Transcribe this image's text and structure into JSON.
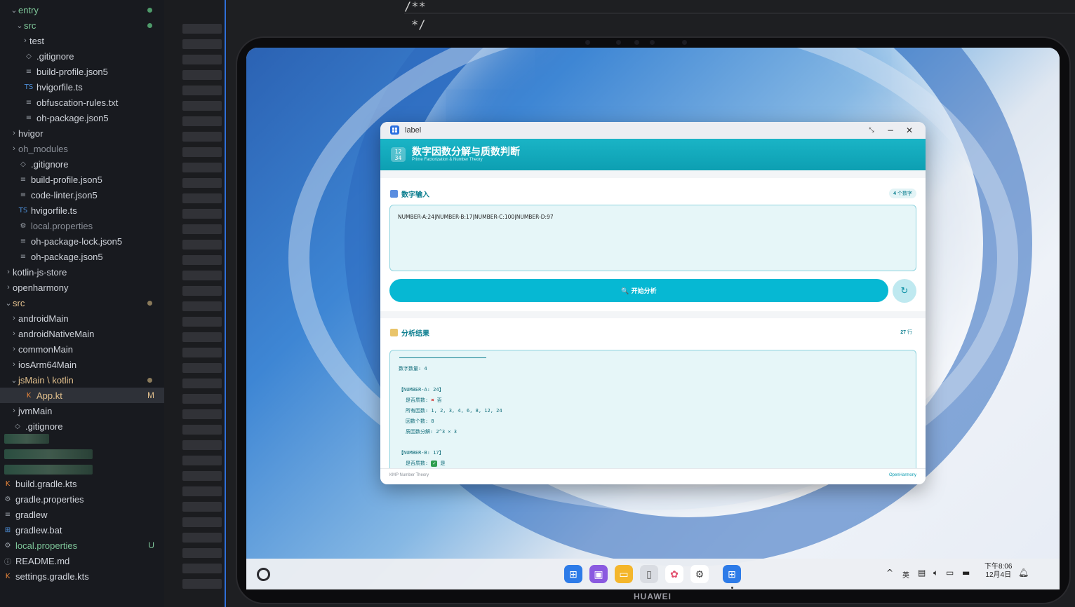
{
  "sidebar": {
    "items": [
      {
        "label": "entry",
        "chev": "⌄",
        "icon": "",
        "indent": 14,
        "color": "green",
        "dot": "#4e9a6a"
      },
      {
        "label": "src",
        "chev": "⌄",
        "icon": "",
        "indent": 22,
        "color": "green",
        "dot": "#4e9a6a"
      },
      {
        "label": "test",
        "chev": "›",
        "icon": "",
        "indent": 30,
        "color": "",
        "dot": ""
      },
      {
        "label": ".gitignore",
        "chev": "",
        "icon": "◇",
        "indent": 22,
        "color": "",
        "dot": ""
      },
      {
        "label": "build-profile.json5",
        "chev": "",
        "icon": "≡",
        "indent": 22,
        "color": "",
        "dot": ""
      },
      {
        "label": "hvigorfile.ts",
        "chev": "",
        "icon": "TS",
        "indent": 22,
        "color": "",
        "dot": ""
      },
      {
        "label": "obfuscation-rules.txt",
        "chev": "",
        "icon": "≡",
        "indent": 22,
        "color": "",
        "dot": ""
      },
      {
        "label": "oh-package.json5",
        "chev": "",
        "icon": "≡",
        "indent": 22,
        "color": "",
        "dot": ""
      },
      {
        "label": "hvigor",
        "chev": "›",
        "icon": "",
        "indent": 14,
        "color": "",
        "dot": ""
      },
      {
        "label": "oh_modules",
        "chev": "›",
        "icon": "",
        "indent": 14,
        "color": "dim",
        "dot": ""
      },
      {
        "label": ".gitignore",
        "chev": "",
        "icon": "◇",
        "indent": 14,
        "color": "",
        "dot": ""
      },
      {
        "label": "build-profile.json5",
        "chev": "",
        "icon": "≡",
        "indent": 14,
        "color": "",
        "dot": ""
      },
      {
        "label": "code-linter.json5",
        "chev": "",
        "icon": "≡",
        "indent": 14,
        "color": "",
        "dot": ""
      },
      {
        "label": "hvigorfile.ts",
        "chev": "",
        "icon": "TS",
        "indent": 14,
        "color": "",
        "dot": ""
      },
      {
        "label": "local.properties",
        "chev": "",
        "icon": "⚙",
        "indent": 14,
        "color": "dim",
        "dot": ""
      },
      {
        "label": "oh-package-lock.json5",
        "chev": "",
        "icon": "≡",
        "indent": 14,
        "color": "",
        "dot": ""
      },
      {
        "label": "oh-package.json5",
        "chev": "",
        "icon": "≡",
        "indent": 14,
        "color": "",
        "dot": ""
      },
      {
        "label": "kotlin-js-store",
        "chev": "›",
        "icon": "",
        "indent": 6,
        "color": "",
        "dot": ""
      },
      {
        "label": "openharmony",
        "chev": "›",
        "icon": "",
        "indent": 6,
        "color": "",
        "dot": ""
      },
      {
        "label": "src",
        "chev": "⌄",
        "icon": "",
        "indent": 6,
        "color": "yellow",
        "dot": "#8a7a5a"
      },
      {
        "label": "androidMain",
        "chev": "›",
        "icon": "",
        "indent": 14,
        "color": "",
        "dot": ""
      },
      {
        "label": "androidNativeMain",
        "chev": "›",
        "icon": "",
        "indent": 14,
        "color": "",
        "dot": ""
      },
      {
        "label": "commonMain",
        "chev": "›",
        "icon": "",
        "indent": 14,
        "color": "",
        "dot": ""
      },
      {
        "label": "iosArm64Main",
        "chev": "›",
        "icon": "",
        "indent": 14,
        "color": "",
        "dot": ""
      },
      {
        "label": "jsMain \\ kotlin",
        "chev": "⌄",
        "icon": "",
        "indent": 14,
        "color": "yellow",
        "dot": "#8a7a5a"
      },
      {
        "label": "App.kt",
        "chev": "",
        "icon": "K",
        "indent": 22,
        "color": "yellow",
        "badge": "M",
        "selected": true
      },
      {
        "label": "jvmMain",
        "chev": "›",
        "icon": "",
        "indent": 14,
        "color": "",
        "dot": ""
      },
      {
        "label": ".gitignore",
        "chev": "",
        "icon": "◇",
        "indent": 6,
        "color": "",
        "dot": ""
      }
    ],
    "bottom_items": [
      {
        "label": "build.gradle.kts",
        "icon": "K"
      },
      {
        "label": "gradle.properties",
        "icon": "⚙"
      },
      {
        "label": "gradlew",
        "icon": "≡"
      },
      {
        "label": "gradlew.bat",
        "icon": "⊞"
      },
      {
        "label": "local.properties",
        "icon": "⚙",
        "color": "green",
        "badge": "U"
      },
      {
        "label": "README.md",
        "icon": "ⓘ"
      },
      {
        "label": "settings.gradle.kts",
        "icon": "K"
      }
    ]
  },
  "editor": {
    "line1": "/**",
    "line2": "*/"
  },
  "device": {
    "brand": "HUAWEI"
  },
  "taskbar": {
    "clock_time": "下午8:06",
    "clock_date": "12月4日",
    "tray_lang": "英",
    "tray_chevron": "^"
  },
  "app": {
    "window_title": "label",
    "header_icon": "12\n34",
    "header_title": "数字因数分解与质数判断",
    "header_subtitle": "Prime Factorization & Number Theory",
    "input_section": {
      "title": "数字输入",
      "count": "4",
      "count_unit": "个数字",
      "value": "NUMBER-A:24|NUMBER-B:17|NUMBER-C:100|NUMBER-D:97"
    },
    "analyze_button": "🔍 开始分析",
    "reset_button": "↻",
    "result_section": {
      "title": "分析结果",
      "count": "27",
      "count_unit": "行",
      "lines": [
        {
          "text": "数字数量: 4",
          "indent": false
        },
        {
          "text": "",
          "indent": false
        },
        {
          "text": "【NUMBER-A: 24】",
          "indent": false
        },
        {
          "text": "是否质数: ",
          "indent": true,
          "mark": "x",
          "mark_text": "否"
        },
        {
          "text": "所有因数: 1, 2, 3, 4, 6, 8, 12, 24",
          "indent": true
        },
        {
          "text": "因数个数: 8",
          "indent": true
        },
        {
          "text": "质因数分解: 2^3 × 3",
          "indent": true
        },
        {
          "text": "",
          "indent": false
        },
        {
          "text": "【NUMBER-B: 17】",
          "indent": false
        },
        {
          "text": "是否质数: ",
          "indent": true,
          "mark": "ok",
          "mark_text": "是"
        }
      ]
    },
    "footer_left": "KMP Number Theory",
    "footer_right": "OpenHarmony"
  },
  "colors": {
    "accent": "#06b8d3",
    "header": "#0d9fb2",
    "section_text": "#0a7d8e"
  }
}
